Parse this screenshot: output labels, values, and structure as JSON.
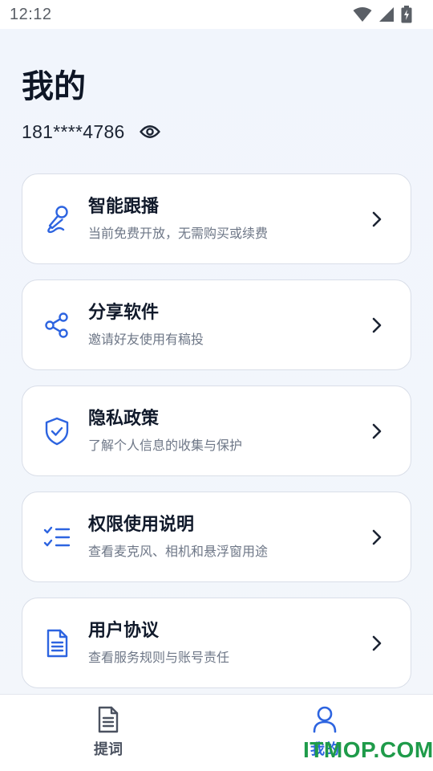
{
  "status_bar": {
    "time": "12:12",
    "icons": [
      "wifi-icon",
      "cellular-signal-icon",
      "battery-charging-icon"
    ]
  },
  "header": {
    "title": "我的",
    "phone": "181****4786",
    "visibility_icon": "eye-icon"
  },
  "menu": [
    {
      "title": "智能跟播",
      "subtitle": "当前免费开放，无需购买或续费",
      "icon": "microphone-icon"
    },
    {
      "title": "分享软件",
      "subtitle": "邀请好友使用有稿投",
      "icon": "share-icon"
    },
    {
      "title": "隐私政策",
      "subtitle": "了解个人信息的收集与保护",
      "icon": "shield-check-icon"
    },
    {
      "title": "权限使用说明",
      "subtitle": "查看麦克风、相机和悬浮窗用途",
      "icon": "checklist-icon"
    },
    {
      "title": "用户协议",
      "subtitle": "查看服务规则与账号责任",
      "icon": "document-icon"
    }
  ],
  "tab_bar": {
    "tabs": [
      {
        "label": "提词",
        "icon": "document-tab-icon",
        "active": false
      },
      {
        "label": "我的",
        "icon": "user-icon",
        "active": true
      }
    ]
  },
  "watermark": "ITMOP.COM",
  "colors": {
    "accent": "#2d64e0",
    "background": "#f2f5fb",
    "card_border": "#d9dee8",
    "title": "#111a2b",
    "subtitle": "#6e7787",
    "watermark": "#1f9b4a"
  }
}
